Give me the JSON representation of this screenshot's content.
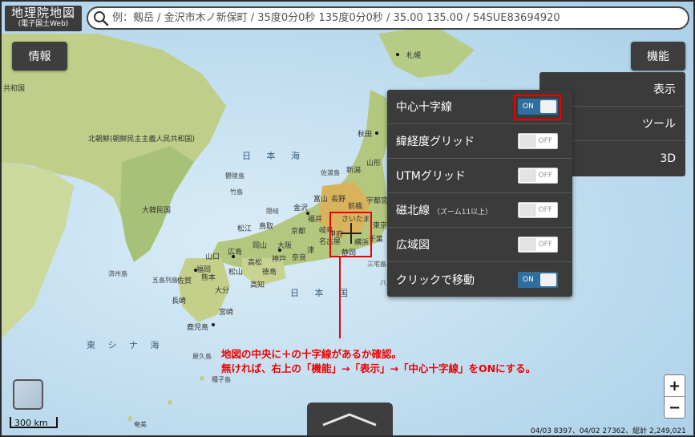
{
  "app": {
    "title": "地理院地図",
    "subtitle": "(電子国土Web)"
  },
  "search": {
    "placeholder": "例：剱岳 / 金沢市木ノ新保町 / 35度0分0秒 135度0分0秒 / 35.00 135.00 / 54SUE83694920",
    "icon": "search-icon"
  },
  "buttons": {
    "info": "情報",
    "function": "機能"
  },
  "function_menu": {
    "items": [
      "表示",
      "ツール",
      "3D"
    ]
  },
  "display_panel": {
    "items": [
      {
        "label": "中心十字線",
        "note": "",
        "state": "ON"
      },
      {
        "label": "緯経度グリッド",
        "note": "",
        "state": "OFF"
      },
      {
        "label": "UTMグリッド",
        "note": "",
        "state": "OFF"
      },
      {
        "label": "磁北線",
        "note": "（ズーム11以上）",
        "state": "OFF"
      },
      {
        "label": "広域図",
        "note": "",
        "state": "OFF"
      },
      {
        "label": "クリックで移動",
        "note": "",
        "state": "ON"
      }
    ]
  },
  "annotation": {
    "line1": "地図の中央に＋の十字線があるか確認。",
    "line2": "無ければ、右上の「機能」→「表示」→「中心十字線」をONにする。"
  },
  "map_labels": {
    "seas": [
      "日 本 海",
      "日 本 国",
      "東 シ ナ 海"
    ],
    "countries": [
      "北朝鮮(朝鮮民主主義人民共和国)",
      "大韓民国",
      "共和国"
    ],
    "places": [
      "札幌",
      "秋田",
      "山形",
      "新潟",
      "佐渡島",
      "長野",
      "前橋",
      "宇都宮",
      "富山",
      "金沢",
      "福井",
      "岐阜",
      "さいたま",
      "東京",
      "千葉",
      "横浜",
      "静岡",
      "甲府",
      "名古屋",
      "津",
      "大阪",
      "京都",
      "奈良",
      "神戸",
      "鳥取",
      "松江",
      "岡山",
      "広島",
      "山口",
      "福岡",
      "佐賀",
      "長崎",
      "熊本",
      "大分",
      "宮崎",
      "鹿児島",
      "高松",
      "徳島",
      "高知",
      "松山",
      "隠岐",
      "竹島",
      "三宅島",
      "八丈島",
      "屋久島",
      "奄美",
      "済州島",
      "鬱陵島",
      "五島列島",
      "種子島"
    ]
  },
  "scale": "300 km",
  "attribution": "04/03 8397、04/02 27362、総計 2,249,021",
  "zoom": {
    "in": "+",
    "out": "−"
  },
  "colors": {
    "panel_bg": "#3b3b3b",
    "toggle_on": "#2f6f9f",
    "highlight": "#e00000"
  }
}
